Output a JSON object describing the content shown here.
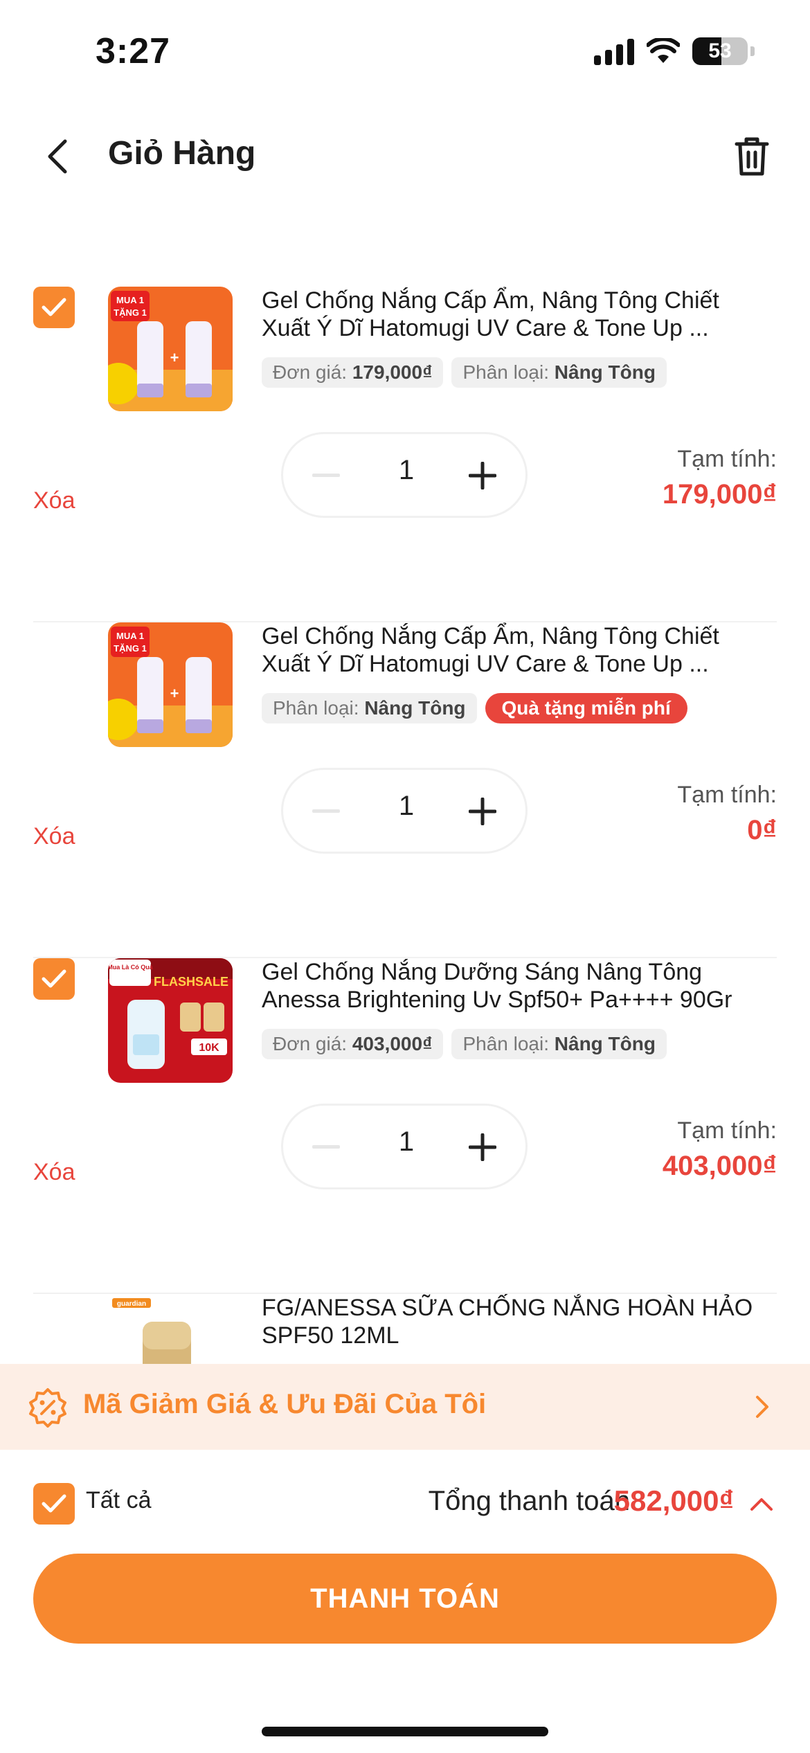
{
  "status_bar": {
    "time": "3:27",
    "battery": "53"
  },
  "header": {
    "title": "Giỏ Hàng"
  },
  "items": [
    {
      "name": "Gel Chống Nắng Cấp Ẩm, Nâng Tông Chiết Xuất Ý Dĩ Hatomugi UV Care & Tone Up ...",
      "unit_price_label": "Đơn giá:",
      "unit_price": "179,000₫",
      "variant_label": "Phân loại:",
      "variant": "Nâng Tông",
      "quantity": "1",
      "remove_label": "Xóa",
      "subtotal_label": "Tạm tính:",
      "subtotal": "179,000₫",
      "thumb_banner": "MUA 1",
      "thumb_badge": "TẶNG 1"
    },
    {
      "name": "Gel Chống Nắng Cấp Ẩm, Nâng Tông Chiết Xuất Ý Dĩ Hatomugi UV Care & Tone Up ...",
      "variant_label": "Phân loại:",
      "variant": "Nâng Tông",
      "gift_tag": "Quà tặng miễn phí",
      "quantity": "1",
      "remove_label": "Xóa",
      "subtotal_label": "Tạm tính:",
      "subtotal": "0₫",
      "thumb_banner": "MUA 1",
      "thumb_badge": "TẶNG 1"
    },
    {
      "name": "Gel Chống Nắng Dưỡng Sáng Nâng Tông Anessa Brightening Uv Spf50+ Pa++++ 90Gr",
      "unit_price_label": "Đơn giá:",
      "unit_price": "403,000₫",
      "variant_label": "Phân loại:",
      "variant": "Nâng Tông",
      "quantity": "1",
      "remove_label": "Xóa",
      "subtotal_label": "Tạm tính:",
      "subtotal": "403,000₫",
      "thumb_banner": "Mua Là Có Quà",
      "thumb_badge": "FLASHSALE",
      "thumb_price": "10K"
    },
    {
      "name": "FG/ANESSA SỮA CHỐNG NẮNG HOÀN HẢO SPF50 12ML",
      "thumb_banner": "guardian"
    }
  ],
  "voucher": {
    "label": "Mã Giảm Giá & Ưu Đãi Của Tôi"
  },
  "footer": {
    "select_all_label": "Tất cả",
    "total_label": "Tổng thanh toán",
    "total_value": "582,000₫",
    "checkout_label": "THANH TOÁN"
  },
  "colors": {
    "accent": "#f7882f",
    "price": "#e8453c",
    "voucher_bg": "#fdeee5",
    "tag_bg": "#f0f0f0"
  },
  "icons": {
    "back": "chevron-left-icon",
    "trash": "trash-icon",
    "check": "check-icon",
    "minus": "minus-icon",
    "plus": "plus-icon",
    "voucher": "discount-badge-icon",
    "chevron_right": "chevron-right-icon",
    "chevron_up": "chevron-up-icon"
  }
}
